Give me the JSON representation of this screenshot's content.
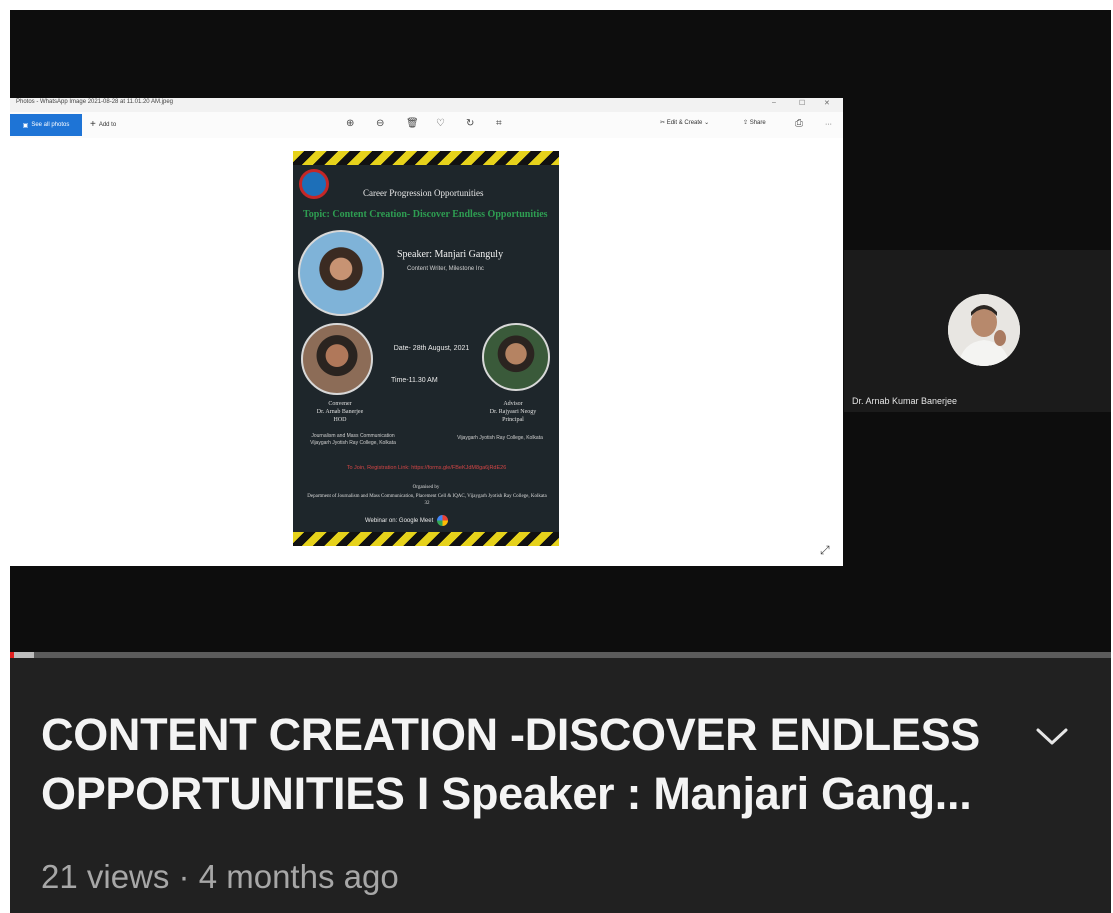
{
  "player": {
    "photo_window": {
      "titlebar_text": "Photos - WhatsApp Image 2021-08-28 at 11.01.20 AM.jpeg",
      "see_all_photos_label": "See all photos",
      "add_to_label": "Add to",
      "edit_create_label": "Edit & Create",
      "share_label": "Share",
      "more_label": "···"
    },
    "poster": {
      "heading": "Career Progression Opportunities",
      "topic": "Topic: Content Creation- Discover Endless Opportunities",
      "speaker_name": "Speaker:  Manjari Ganguly",
      "speaker_role": "Content Writer, Milestone Inc",
      "date": "Date- 28th August, 2021",
      "time": "Time-11.30 AM",
      "convener_title": "Convener",
      "convener_name": "Dr. Arnab Banerjee",
      "convener_role": "HOD",
      "convener_dept": "Journalism and Mass Communication",
      "convener_college": "Vijaygarh Jyotish Ray College, Kolkata",
      "advisor_title": "Advisor",
      "advisor_name": "Dr. Rajyasri Neogy",
      "advisor_role": "Principal",
      "advisor_college": "Vijaygarh Jyotish Ray College, Kolkata",
      "registration": "To Join, Registration Link: https://forms.gle/FBeKJdM8ga6jRdE26",
      "organised_label": "Organised by",
      "organised_by": "Department of Journalism and Mass Communication, Placement Cell & IQAC, Vijaygarh Jyotish Ray College, Kolkata 32",
      "webinar": "Webinar on: Google Meet"
    },
    "participant": {
      "name": "Dr. Arnab Kumar Banerjee"
    },
    "progress": {
      "played_fraction": 0.004,
      "buffered_fraction": 0.022,
      "played_color": "#e01e1e"
    }
  },
  "video_info": {
    "title": "CONTENT CREATION -DISCOVER ENDLESS OPPORTUNITIES I Speaker : Manjari Gang...",
    "meta": "21 views · 4 months ago",
    "expand_icon": "chevron-down-icon"
  }
}
